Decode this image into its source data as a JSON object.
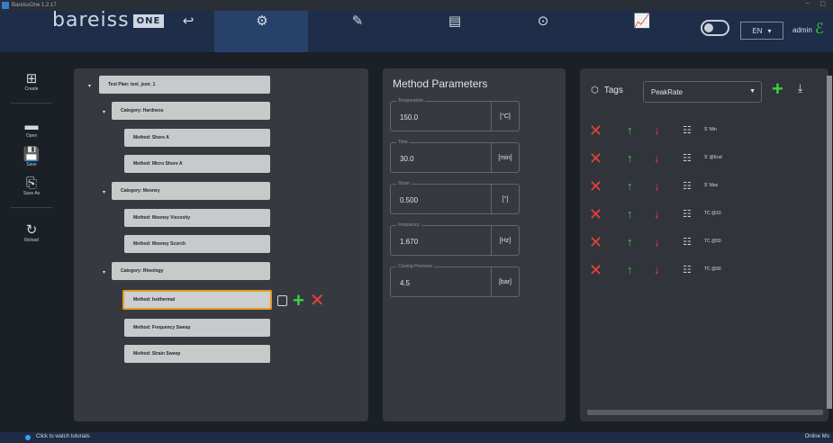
{
  "window": {
    "title": "BareissOne 1.2.17",
    "minimize": "–",
    "maximize": "▢"
  },
  "navbar": {
    "logo_text": "bareiss",
    "logo_badge": "ONE",
    "icons": [
      "login-icon",
      "gear-icon",
      "syringe-icon",
      "document-icon",
      "play-icon",
      "chart-icon"
    ],
    "language": "EN",
    "user": "admin"
  },
  "sidebar": {
    "create": "Create",
    "open": "Open",
    "save": "Save",
    "save_as": "Save As",
    "reload": "Reload"
  },
  "tree": {
    "plan": "Test Plan: test_json_1",
    "categories": [
      {
        "label": "Category: Hardness",
        "methods": [
          "Method: Shore A",
          "Method: Micro Shore A"
        ]
      },
      {
        "label": "Category: Mooney",
        "methods": [
          "Method: Mooney Viscosity",
          "Method: Mooney Scorch"
        ]
      },
      {
        "label": "Category: Rheology",
        "methods": [
          "Method: Isothermal",
          "Method: Frequency Sweep",
          "Method: Strain Sweep"
        ]
      }
    ],
    "selected": "Method: Isothermal"
  },
  "method_params": {
    "title": "Method Parameters",
    "fields": [
      {
        "label": "Temperature",
        "value": "150.0",
        "unit": "[°C]"
      },
      {
        "label": "Time",
        "value": "30.0",
        "unit": "[min]"
      },
      {
        "label": "Strain",
        "value": "0.500",
        "unit": "[°]"
      },
      {
        "label": "Frequency",
        "value": "1.670",
        "unit": "[Hz]"
      },
      {
        "label": "Closing Pressure",
        "value": "4.5",
        "unit": "[bar]"
      }
    ]
  },
  "tags": {
    "label": "Tags",
    "selected": "PeakRate",
    "rows": [
      "S' Min",
      "S' @End",
      "S' Max",
      "TC @10",
      "TC @50",
      "TC @90"
    ]
  },
  "status": {
    "tip": "Click to watch tutorials",
    "right": "Online Mo"
  }
}
